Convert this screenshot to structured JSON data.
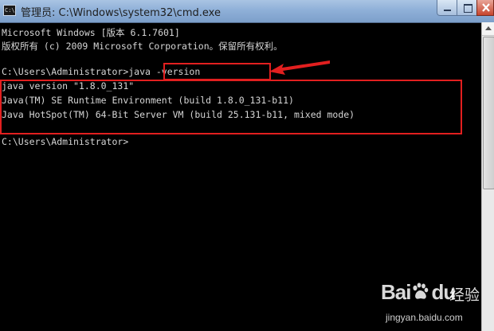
{
  "window": {
    "title": "管理员: C:\\Windows\\system32\\cmd.exe",
    "icon_text": "C:\\"
  },
  "console": {
    "lines": [
      "Microsoft Windows [版本 6.1.7601]",
      "版权所有 (c) 2009 Microsoft Corporation。保留所有权利。",
      "",
      "C:\\Users\\Administrator>java -version",
      "java version \"1.8.0_131\"",
      "Java(TM) SE Runtime Environment (build 1.8.0_131-b11)",
      "Java HotSpot(TM) 64-Bit Server VM (build 25.131-b11, mixed mode)",
      "",
      "C:\\Users\\Administrator>"
    ],
    "prompt": "C:\\Users\\Administrator>",
    "command": "java -version"
  },
  "watermark": {
    "brand": "Bai",
    "brand_suffix": "du",
    "name": "经验",
    "url": "jingyan.baidu.com"
  },
  "colors": {
    "highlight": "#e21f1f",
    "console_bg": "#000000",
    "console_fg": "#d6d6d6"
  },
  "icons": [
    "cmd-app-icon",
    "minimize-icon",
    "maximize-icon",
    "close-icon",
    "red-arrow-icon",
    "baidu-paw-icon"
  ]
}
